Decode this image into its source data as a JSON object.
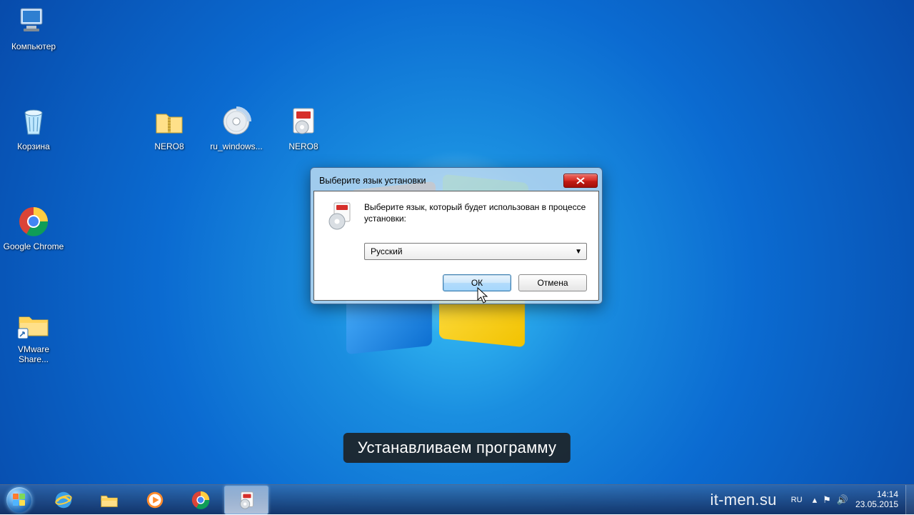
{
  "desktop_icons": {
    "computer": "Компьютер",
    "recycle_bin": "Корзина",
    "chrome": "Google Chrome",
    "vmware": "VMware Share...",
    "nero_zip": "NERO8",
    "ru_windows": "ru_windows...",
    "nero_pkg": "NERO8"
  },
  "dialog": {
    "title": "Выберите язык установки",
    "message": "Выберите язык, который будет использован в процессе установки:",
    "selected_language": "Русский",
    "ok_label": "ОК",
    "cancel_label": "Отмена"
  },
  "caption": "Устанавливаем программу",
  "taskbar": {
    "watermark": "it-men.su",
    "language_indicator": "RU",
    "time": "14:14",
    "date": "23.05.2015"
  }
}
